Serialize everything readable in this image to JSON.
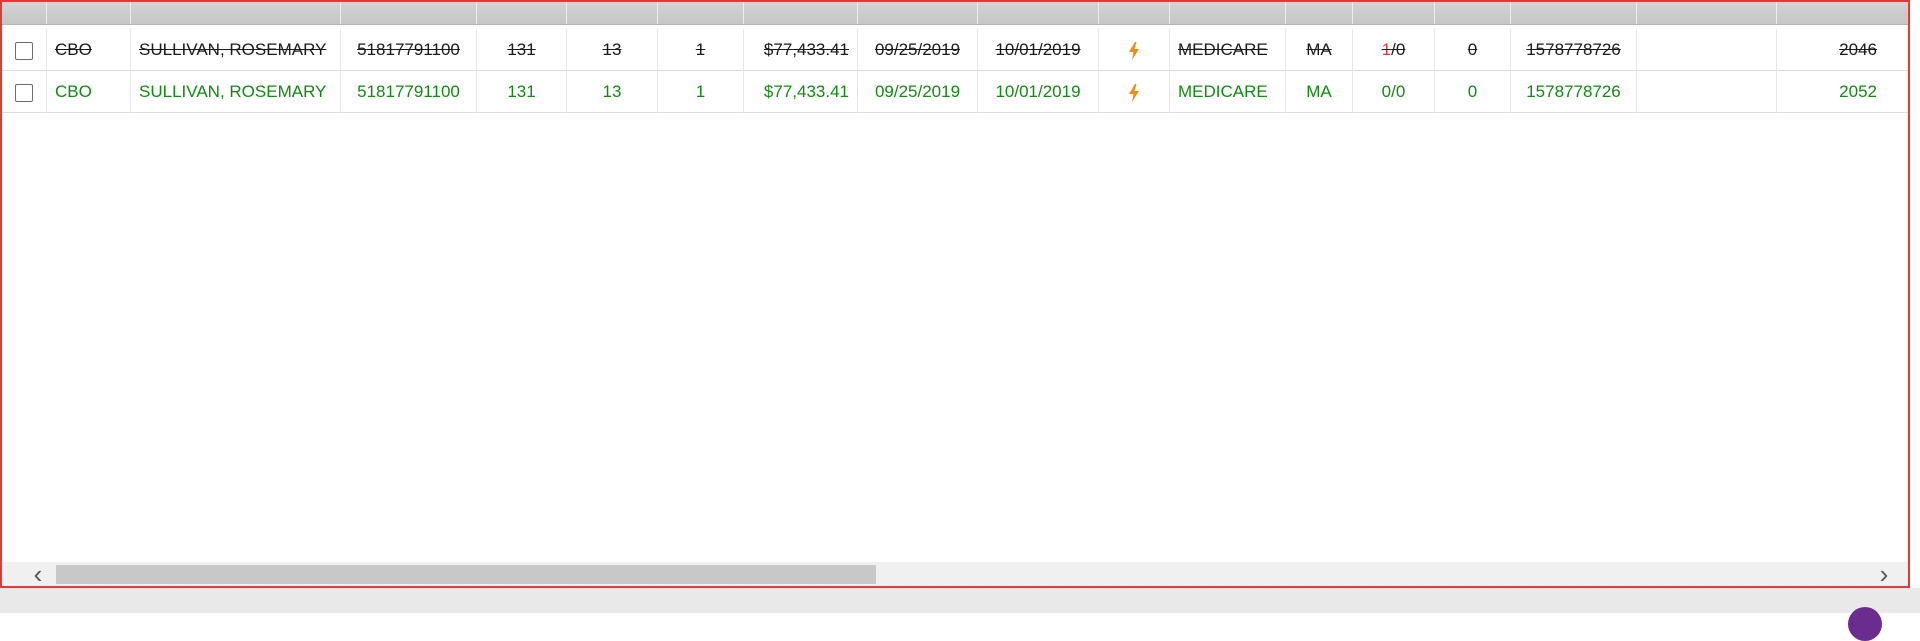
{
  "table": {
    "rows": [
      {
        "state": "superseded",
        "facility": "CBO",
        "patient": "SULLIVAN, ROSEMARY",
        "account": "51817791100",
        "code_a": "131",
        "code_b": "13",
        "count": "1",
        "amount": "$77,433.41",
        "date_from": "09/25/2019",
        "date_to": "10/01/2019",
        "icon": "lightning-icon",
        "payer": "MEDICARE",
        "state_code": "MA",
        "ratio_left": "1",
        "ratio_right": "/0",
        "zero": "0",
        "npi": "1578778726",
        "blank": "",
        "last": "2046"
      },
      {
        "state": "current",
        "facility": "CBO",
        "patient": "SULLIVAN, ROSEMARY",
        "account": "51817791100",
        "code_a": "131",
        "code_b": "13",
        "count": "1",
        "amount": "$77,433.41",
        "date_from": "09/25/2019",
        "date_to": "10/01/2019",
        "icon": "lightning-icon",
        "payer": "MEDICARE",
        "state_code": "MA",
        "ratio_left": "0",
        "ratio_right": "/0",
        "zero": "0",
        "npi": "1578778726",
        "blank": "",
        "last": "2052"
      }
    ]
  },
  "colors": {
    "frame_border": "#e53935",
    "current_row_text": "#118a11",
    "superseded_row_text": "#1a1a1a",
    "bolt": "#f08a12"
  },
  "scrollbar": {
    "left_arrow": "‹",
    "right_arrow": "›"
  }
}
